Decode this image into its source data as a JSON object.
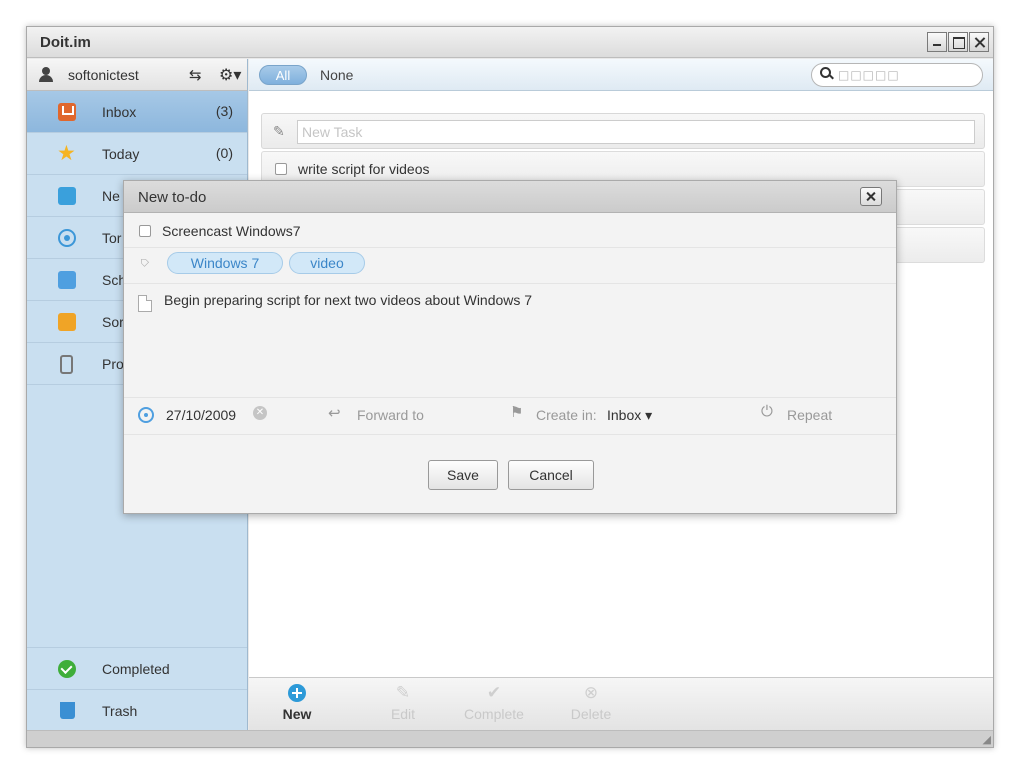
{
  "window": {
    "title": "Doit.im"
  },
  "user": {
    "name": "softonictest"
  },
  "sidebar": {
    "items": [
      {
        "label": "Inbox",
        "count": "(3)",
        "icon": "inbox-icon"
      },
      {
        "label": "Today",
        "count": "(0)",
        "icon": "star-icon"
      },
      {
        "label": "Ne",
        "count": "",
        "icon": "next-icon"
      },
      {
        "label": "Tor",
        "count": "",
        "icon": "tomorrow-icon"
      },
      {
        "label": "Sch",
        "count": "",
        "icon": "calendar-icon"
      },
      {
        "label": "Sor",
        "count": "",
        "icon": "someday-icon"
      },
      {
        "label": "Pro",
        "count": "",
        "icon": "projects-icon"
      }
    ],
    "bottom_items": [
      {
        "label": "Completed",
        "icon": "check-icon"
      },
      {
        "label": "Trash",
        "icon": "trash-icon"
      }
    ]
  },
  "filters": {
    "all": "All",
    "none": "None"
  },
  "search": {
    "placeholder": "□□□□□"
  },
  "new_task": {
    "placeholder": "New Task"
  },
  "tasks": [
    {
      "label": "write script for videos"
    }
  ],
  "toolbar": {
    "new": "New",
    "edit": "Edit",
    "complete": "Complete",
    "delete": "Delete"
  },
  "dialog": {
    "title": "New to-do",
    "todo_title": "Screencast Windows7",
    "tags": [
      "Windows 7",
      "video"
    ],
    "notes": "Begin preparing script for next two videos about Windows 7",
    "date": "27/10/2009",
    "forward_label": "Forward to",
    "create_in_label": "Create in:",
    "create_in_value": "Inbox ▾",
    "repeat_label": "Repeat",
    "save_label": "Save",
    "cancel_label": "Cancel"
  },
  "colors": {
    "sidebar_bg": "#c9dff0",
    "sidebar_active": "#8db7dd",
    "accent": "#2d9ad8",
    "tag_bg": "#d2e8f8",
    "tag_text": "#3b86c8"
  }
}
